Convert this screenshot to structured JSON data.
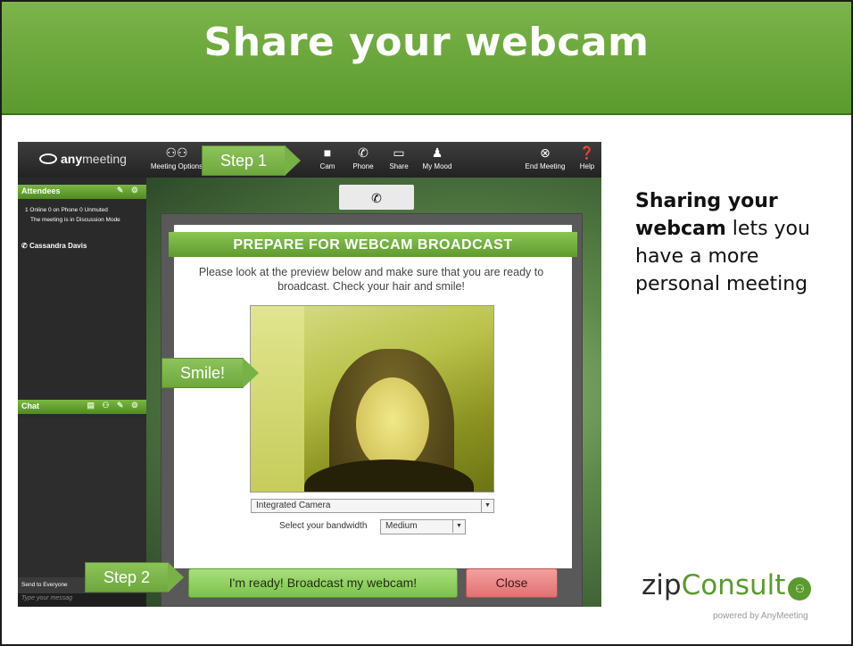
{
  "slide": {
    "title": "Share your webcam"
  },
  "app": {
    "brand_pre": "any",
    "brand_post": "meeting",
    "toolbar": [
      {
        "label": "Meeting Options",
        "icon": "people-icon"
      },
      {
        "label": "Cam",
        "icon": "camera-icon"
      },
      {
        "label": "Phone",
        "icon": "phone-icon"
      },
      {
        "label": "Share",
        "icon": "monitor-icon"
      },
      {
        "label": "My Mood",
        "icon": "person-icon"
      },
      {
        "label": "End Meeting",
        "icon": "close-circle-icon"
      },
      {
        "label": "Help",
        "icon": "help-icon"
      }
    ],
    "attendees": {
      "header": "Attendees",
      "stats": "1 Online    0 on Phone    0 Unmuted",
      "mode": "The meeting is in Discussion Mode",
      "user": "Cassandra Davis"
    },
    "chat": {
      "header": "Chat",
      "send_label": "Send to Everyone",
      "placeholder": "Type your messag"
    }
  },
  "dialog": {
    "title": "PREPARE FOR WEBCAM BROADCAST",
    "instructions": "Please look at the preview below and make sure that you are ready to broadcast.  Check your hair and smile!",
    "camera_value": "Integrated Camera",
    "bandwidth_label": "Select your bandwidth",
    "bandwidth_value": "Medium",
    "ready_button": "I'm ready! Broadcast my webcam!",
    "close_button": "Close"
  },
  "callouts": {
    "step1": "Step 1",
    "step2": "Step 2",
    "smile": "Smile!"
  },
  "side": {
    "bold": "Sharing your webcam",
    "rest": " lets you have a more personal meeting"
  },
  "logo": {
    "zip": "zip",
    "consult": "Consult",
    "tagline": "powered by AnyMeeting"
  }
}
